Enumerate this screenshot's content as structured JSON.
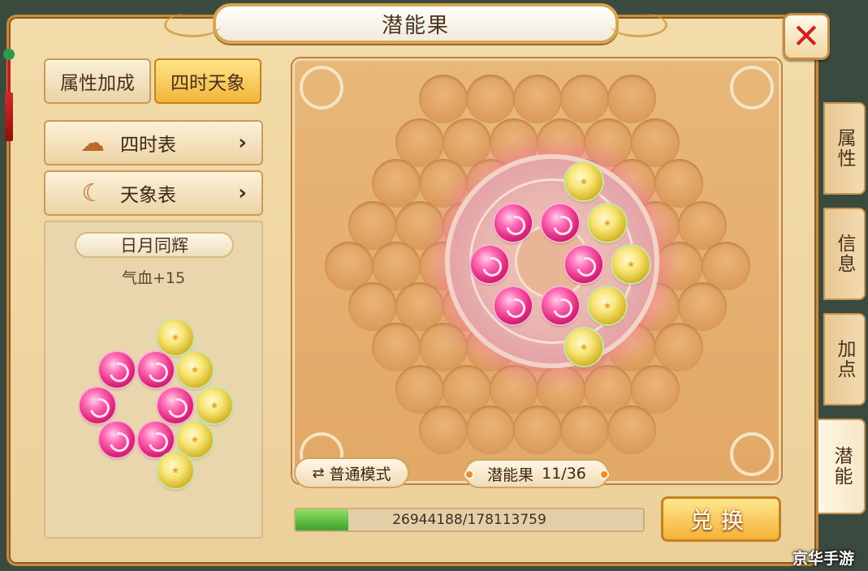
{
  "window": {
    "title": "潜能果",
    "close_icon": "close-x-icon"
  },
  "left": {
    "tabs": [
      {
        "label": "属性加成",
        "active": false
      },
      {
        "label": "四时天象",
        "active": true
      }
    ],
    "menus": [
      {
        "label": "四时表",
        "icon": "cloud-icon"
      },
      {
        "label": "天象表",
        "icon": "moon-icon"
      }
    ],
    "combo": {
      "name": "日月同辉",
      "effect": "气血+15"
    }
  },
  "board": {
    "mode_label": "普通模式",
    "count_label": "潜能果",
    "count_value": "11/36",
    "progress_text": "26944188/178113759",
    "progress_fraction": 0.151,
    "exchange_label": "兑换"
  },
  "side_tabs": [
    "属性",
    "信息",
    "加点",
    "潜能"
  ],
  "watermark": "京华手游",
  "colors": {
    "pink_orb": "#e0287e",
    "gold_orb": "#f9e678",
    "accent": "#f4b137"
  }
}
